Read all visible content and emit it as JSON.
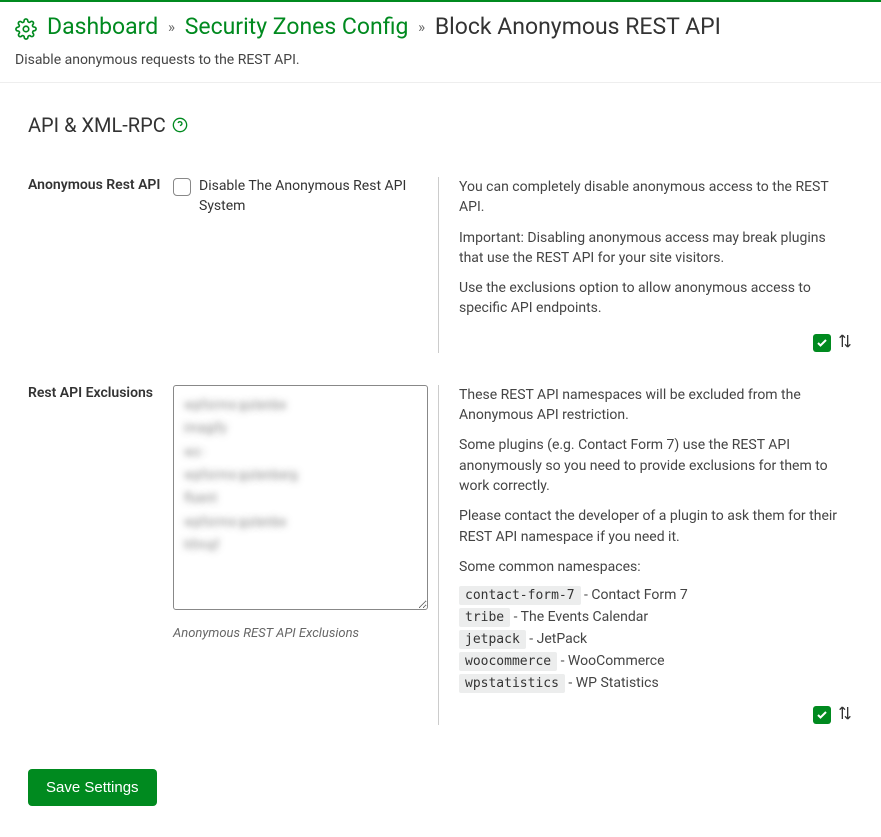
{
  "breadcrumb": {
    "dashboard": "Dashboard",
    "zones": "Security Zones Config",
    "current": "Block Anonymous REST API"
  },
  "subtitle": "Disable anonymous requests to the REST API.",
  "section_title": "API & XML-RPC",
  "option1": {
    "label": "Anonymous Rest API",
    "checkbox_label": "Disable The Anonymous Rest API System",
    "desc1": "You can completely disable anonymous access to the REST API.",
    "desc2": "Important: Disabling anonymous access may break plugins that use the REST API for your site visitors.",
    "desc3": "Use the exclusions option to allow anonymous access to specific API endpoints."
  },
  "option2": {
    "label": "Rest API Exclusions",
    "textarea_value": "wpforms-gutenbe\nimagify\nwc-\nwpforms-gutenberg\nfluent\nwpforms-gutenbe\nhfmqf",
    "caption": "Anonymous REST API Exclusions",
    "desc1": "These REST API namespaces will be excluded from the Anonymous API restriction.",
    "desc2": "Some plugins (e.g. Contact Form 7) use the REST API anonymously so you need to provide exclusions for them to work correctly.",
    "desc3": "Please contact the developer of a plugin to ask them for their REST API namespace if you need it.",
    "desc4": "Some common namespaces:",
    "ns": [
      {
        "code": "contact-form-7",
        "name": " - Contact Form 7"
      },
      {
        "code": "tribe",
        "name": " - The Events Calendar"
      },
      {
        "code": "jetpack",
        "name": " - JetPack"
      },
      {
        "code": "woocommerce",
        "name": " - WooCommerce"
      },
      {
        "code": "wpstatistics",
        "name": " - WP Statistics"
      }
    ]
  },
  "save_label": "Save Settings"
}
